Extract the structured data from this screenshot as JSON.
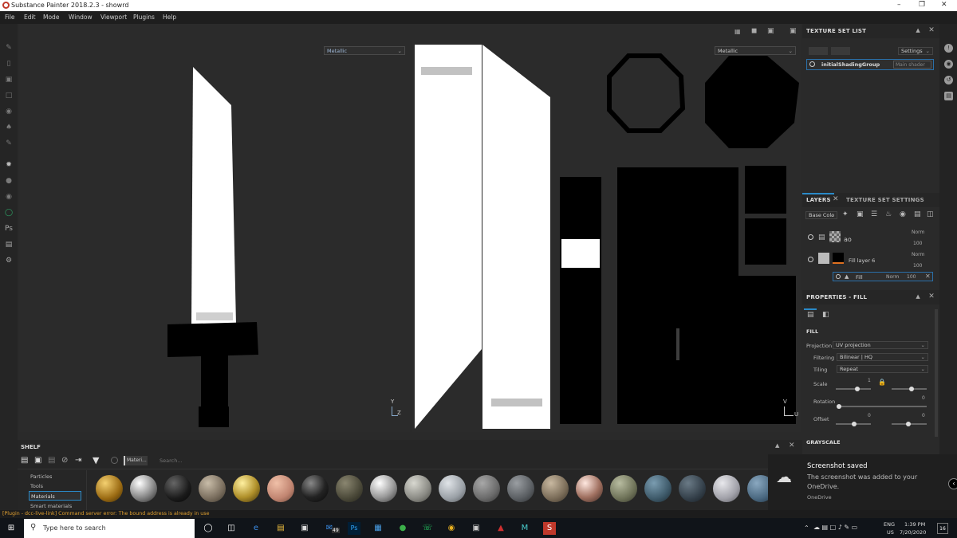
{
  "window": {
    "title": "Substance Painter 2018.2.3 - showrd",
    "minimize": "–",
    "maximize": "❐",
    "close": "✕"
  },
  "menu": [
    "File",
    "Edit",
    "Mode",
    "Window",
    "Viewport",
    "Plugins",
    "Help"
  ],
  "viewport3d": {
    "channel": "Metallic",
    "axis_y": "Y",
    "axis_z": "Z"
  },
  "viewport2d": {
    "channel": "Metallic",
    "axis_v": "V",
    "axis_u": "U"
  },
  "texture_set_list": {
    "title": "TEXTURE SET LIST",
    "settings_label": "Settings",
    "item_name": "initialShadingGroup",
    "item_shader": "Main shader"
  },
  "layers": {
    "tab_layers": "LAYERS",
    "tab_tss": "TEXTURE SET SETTINGS",
    "channel_select": "Base Colo",
    "rows": [
      {
        "name": "ao",
        "blend": "Norm",
        "opacity": "100"
      },
      {
        "name": "Fill layer 6",
        "blend": "Norm",
        "opacity": "100"
      },
      {
        "name": "Fill",
        "blend": "Norm",
        "opacity": "100"
      }
    ]
  },
  "properties": {
    "title": "PROPERTIES - FILL",
    "section_fill": "FILL",
    "projection_label": "Projection",
    "projection_value": "UV projection",
    "filtering_label": "Filtering",
    "filtering_value": "Bilinear | HQ",
    "tiling_label": "Tiling",
    "tiling_value": "Repeat",
    "scale_label": "Scale",
    "scale_value": "1",
    "rotation_label": "Rotation",
    "rotation_value": "0",
    "offset_label": "Offset",
    "offset_value_a": "0",
    "offset_value_b": "0",
    "section_grayscale": "GRAYSCALE"
  },
  "shelf": {
    "title": "SHELF",
    "filter_tag": "Materi...",
    "search_placeholder": "Search...",
    "categories": [
      "Particles",
      "Tools",
      "Materials",
      "Smart materials"
    ],
    "selected_category": "Materials"
  },
  "status": "[Plugin - dcc-live-link] Command server error: The bound address is already in use",
  "toast": {
    "title": "Screenshot saved",
    "body": "The screenshot was added to your OneDrive.",
    "source": "OneDrive"
  },
  "taskbar": {
    "search_placeholder": "Type here to search",
    "lang": "ENG",
    "region": "US",
    "time": "1:39 PM",
    "date": "7/20/2020",
    "notif_count": "16",
    "mail_badge": "49"
  },
  "colors": {
    "accent": "#2a8ac8",
    "status_warning": "#e0a030"
  }
}
